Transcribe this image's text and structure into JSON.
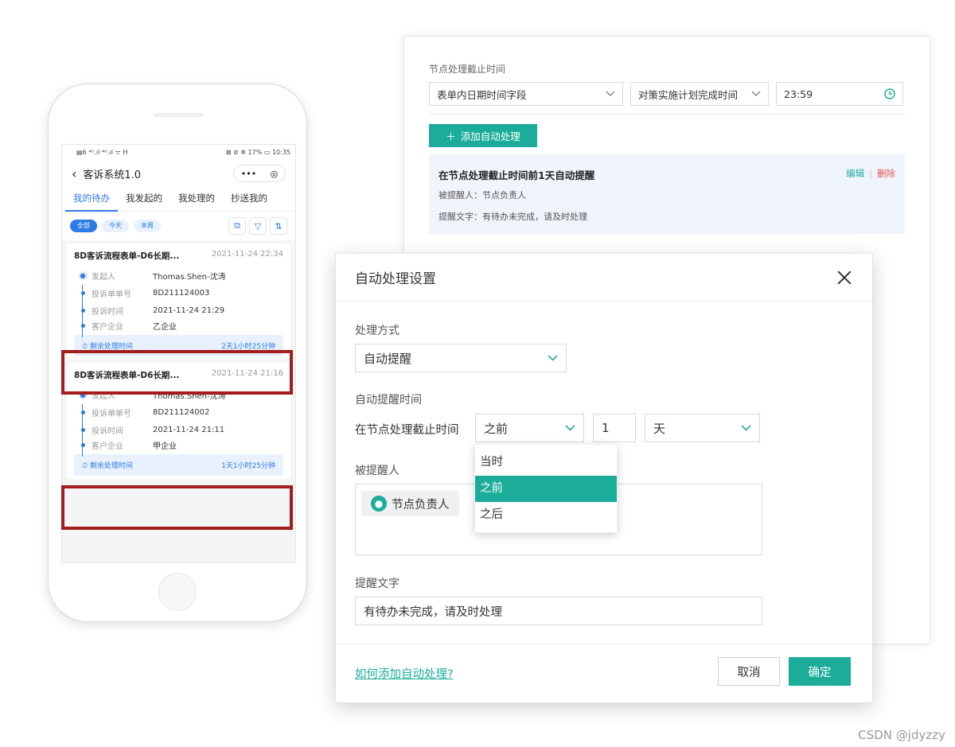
{
  "phone": {
    "status_left": "▤6 ⁴ᴳ.ıl ⁴ᴳ.ıl ᯤ H",
    "status_right": "⊠ ⊘ ✲ 17% ▭ 10:35",
    "nav_back": "‹",
    "title": "客诉系统1.0",
    "capsule_more": "•••",
    "capsule_close": "◎",
    "tabs": [
      {
        "label": "我的待办"
      },
      {
        "label": "我发起的"
      },
      {
        "label": "我处理的"
      },
      {
        "label": "抄送我的"
      }
    ],
    "filters": [
      {
        "label": "全部"
      },
      {
        "label": "今天"
      },
      {
        "label": "本周"
      }
    ],
    "field_labels": [
      "发起人",
      "投诉单单号",
      "投诉时间",
      "客户企业"
    ],
    "remaining_label": "剩余处理时间",
    "cards": [
      {
        "title": "8D客诉流程表单-D6长期...",
        "time": "2021-11-24 22:34",
        "initiator": "Thomas.Shen-沈涛",
        "order_no": "8D211124003",
        "complaint_time": "2021-11-24 21:29",
        "company": "乙企业",
        "remaining": "2天1小时25分钟"
      },
      {
        "title": "8D客诉流程表单-D6长期...",
        "time": "2021-11-24 21:16",
        "initiator": "Thomas.Shen-沈涛",
        "order_no": "8D211124002",
        "complaint_time": "2021-11-24 21:11",
        "company": "甲企业",
        "remaining": "1天1小时25分钟"
      }
    ]
  },
  "back_panel": {
    "deadline_label": "节点处理截止时间",
    "field_select": "表单内日期时间字段",
    "plan_select": "对策实施计划完成时间",
    "time_value": "23:59",
    "add_button": "添加自动处理",
    "rule": {
      "title": "在节点处理截止时间前1天自动提醒",
      "edit": "编辑",
      "delete": "删除",
      "recipient_line": "被提醒人：节点负责人",
      "text_line": "提醒文字：有待办未完成，请及时处理"
    }
  },
  "dialog": {
    "title": "自动处理设置",
    "method_label": "处理方式",
    "method_value": "自动提醒",
    "remind_time_label": "自动提醒时间",
    "deadline_text": "在节点处理截止时间",
    "relation_value": "之前",
    "amount_value": "1",
    "unit_value": "天",
    "relation_options": [
      {
        "label": "当时"
      },
      {
        "label": "之前"
      },
      {
        "label": "之后"
      }
    ],
    "recipient_label": "被提醒人",
    "recipient_tag": "节点负责人",
    "reminder_label": "提醒文字",
    "reminder_text": "有待办未完成，请及时处理",
    "help_link": "如何添加自动处理?",
    "cancel": "取消",
    "confirm": "确定"
  },
  "watermark": "CSDN @jdyzzy",
  "colors": {
    "accent_teal": "#1bac9a",
    "mobile_blue": "#2d7be5",
    "highlight_red": "#a31d1d"
  }
}
